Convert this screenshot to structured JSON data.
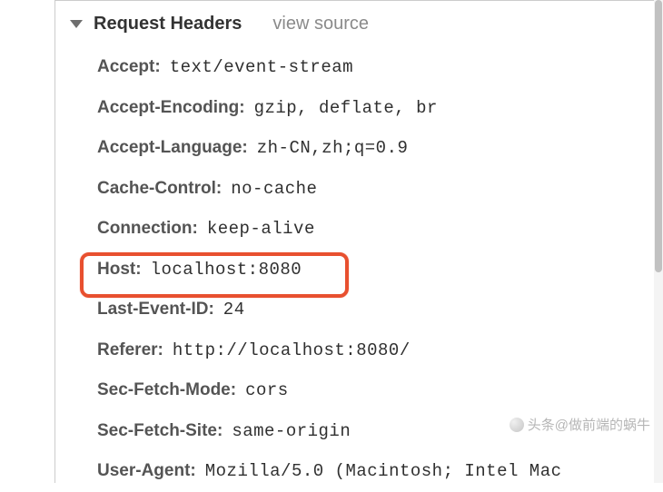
{
  "section": {
    "title": "Request Headers",
    "viewSourceLabel": "view source"
  },
  "headers": [
    {
      "name": "Accept:",
      "value": "text/event-stream"
    },
    {
      "name": "Accept-Encoding:",
      "value": "gzip, deflate, br"
    },
    {
      "name": "Accept-Language:",
      "value": "zh-CN,zh;q=0.9"
    },
    {
      "name": "Cache-Control:",
      "value": "no-cache"
    },
    {
      "name": "Connection:",
      "value": "keep-alive"
    },
    {
      "name": "Host:",
      "value": "localhost:8080"
    },
    {
      "name": "Last-Event-ID:",
      "value": "24"
    },
    {
      "name": "Referer:",
      "value": "http://localhost:8080/"
    },
    {
      "name": "Sec-Fetch-Mode:",
      "value": "cors"
    },
    {
      "name": "Sec-Fetch-Site:",
      "value": "same-origin"
    },
    {
      "name": "User-Agent:",
      "value": "Mozilla/5.0 (Macintosh; Intel Mac"
    }
  ],
  "highlightedIndex": 6,
  "watermark": "头条@做前端的蜗牛"
}
